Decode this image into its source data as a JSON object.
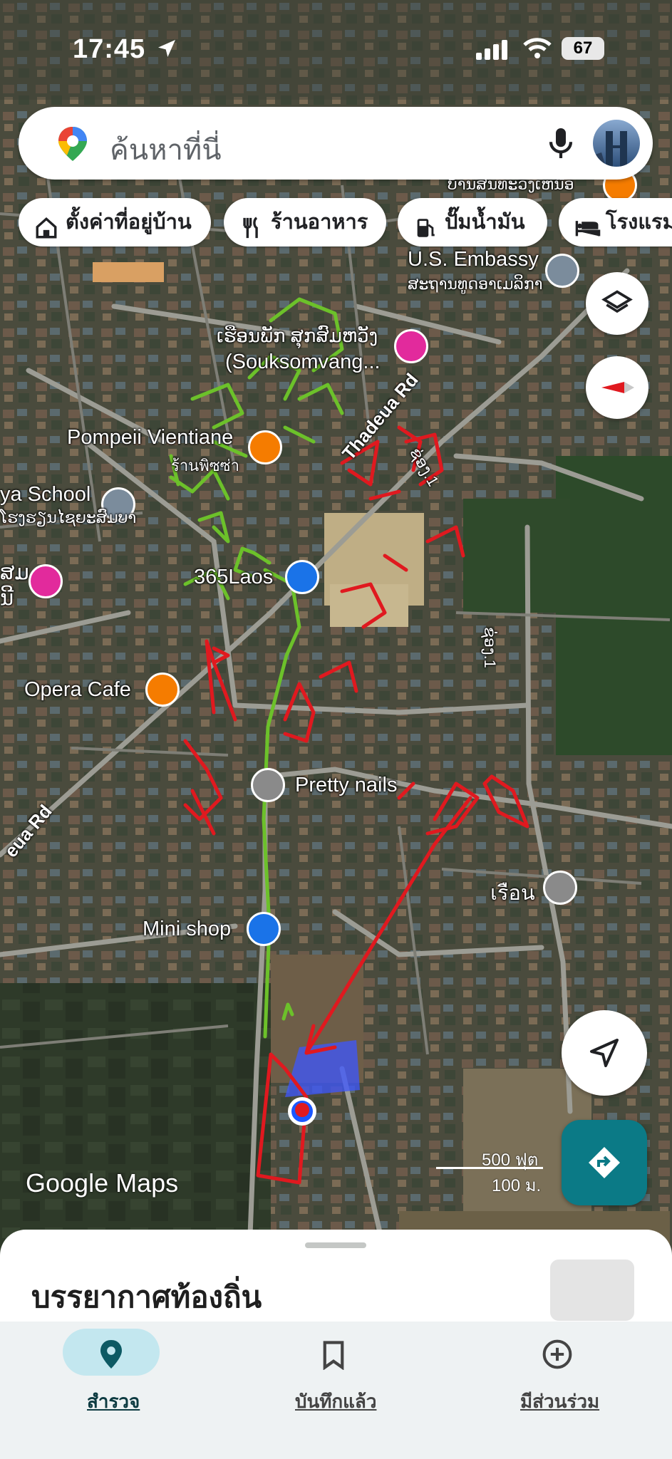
{
  "status_bar": {
    "time": "17:45",
    "battery": "67"
  },
  "search": {
    "placeholder": "ค้นหาที่นี่"
  },
  "chips": [
    {
      "label": "ตั้งค่าที่อยู่บ้าน",
      "icon": "home-icon"
    },
    {
      "label": "ร้านอาหาร",
      "icon": "restaurant-icon"
    },
    {
      "label": "ปั๊มน้ำมัน",
      "icon": "gas-station-icon"
    },
    {
      "label": "โรงแรม",
      "icon": "hotel-icon"
    }
  ],
  "map": {
    "places": {
      "top_partial": "ບ້ານສິນທະວົງເຫນືອ",
      "us_embassy": "U.S. Embassy",
      "us_embassy_local": "ສະຖານທູດອາເມລິກາ",
      "hotel_local": "ເຮືອນພັກ ສຸກສົມຫວັງ",
      "hotel_en": "(Souksomvang...",
      "pompeii": "Pompeii Vientiane",
      "pompeii_local": "ร้านพิซซ่า",
      "school": "ya School",
      "school_local": "ໂຮງຮຽນໄຊຍະສົມບາ",
      "left_partial_1": "ສມ",
      "left_partial_2": "ນີ",
      "shop_365": "365Laos",
      "opera": "Opera Cafe",
      "pretty_nails": "Pretty nails",
      "mini_shop": "Mini shop",
      "house": "เรือน"
    },
    "roads": {
      "thadeua_1": "Thadeua Rd",
      "thadeua_2": "eua Rd",
      "lane_1a": "ຊ່ອງ.1",
      "lane_1b": "ຊ່ອງ.1"
    },
    "attribution": "Google Maps",
    "scale_ft": "500 ฟุต",
    "scale_m": "100 ม."
  },
  "sheet": {
    "title": "บรรยากาศท้องถิ่น"
  },
  "nav": [
    {
      "label": "สำรวจ",
      "icon": "explore-pin-icon",
      "active": true
    },
    {
      "label": "บันทึกแล้ว",
      "icon": "bookmark-icon",
      "active": false
    },
    {
      "label": "มีส่วนร่วม",
      "icon": "add-circle-icon",
      "active": false
    }
  ],
  "colors": {
    "accent_teal": "#0b7a86",
    "active_pill": "#c3e7ef",
    "annotation_red": "#e0191f",
    "annotation_green": "#6cc12a"
  }
}
